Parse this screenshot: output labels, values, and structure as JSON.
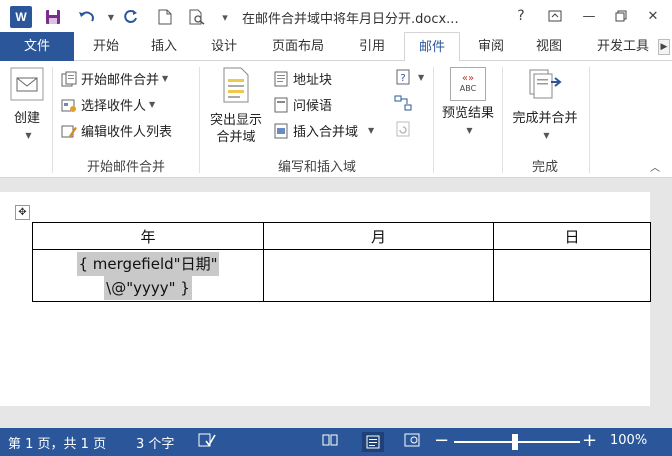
{
  "titlebar": {
    "app_logo": "W",
    "title": "在邮件合并域中将年月日分开.docx...",
    "help": "?",
    "minimize": "—",
    "close": "✕"
  },
  "tabs": [
    {
      "label": "文件"
    },
    {
      "label": "开始"
    },
    {
      "label": "插入"
    },
    {
      "label": "设计"
    },
    {
      "label": "页面布局"
    },
    {
      "label": "引用"
    },
    {
      "label": "邮件"
    },
    {
      "label": "审阅"
    },
    {
      "label": "视图"
    },
    {
      "label": "开发工具"
    }
  ],
  "ribbon": {
    "create": {
      "label": "创建"
    },
    "start_group": {
      "label": "开始邮件合并",
      "start_mail_merge": "开始邮件合并",
      "select_recipients": "选择收件人",
      "edit_recipients": "编辑收件人列表"
    },
    "write_group": {
      "label": "编写和插入域",
      "highlight_line1": "突出显示",
      "highlight_line2": "合并域",
      "address_block": "地址块",
      "greeting_line": "问候语",
      "insert_field": "插入合并域"
    },
    "preview": {
      "label": "预览结果",
      "icon_text": "ABC"
    },
    "finish_group": {
      "label": "完成",
      "finish_merge": "完成并合并"
    }
  },
  "table": {
    "headers": [
      "年",
      "月",
      "日"
    ],
    "field_line1": "{  mergefield\"日期\"",
    "field_line2": "\\@\"yyyy\"  }"
  },
  "statusbar": {
    "page": "第 1 页，共 1 页",
    "words": "3 个字",
    "zoom_minus": "−",
    "zoom_plus": "+",
    "zoom": "100%",
    "zoom_level": 1.0
  }
}
